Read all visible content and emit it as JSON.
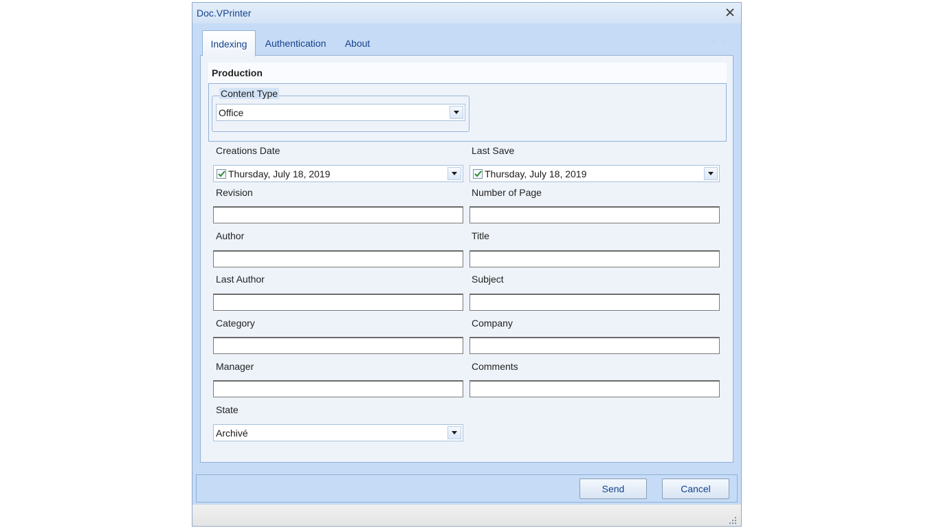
{
  "window": {
    "title": "Doc.VPrinter"
  },
  "tabs": {
    "indexing": "Indexing",
    "authentication": "Authentication",
    "about": "About"
  },
  "production": {
    "header": "Production",
    "content_type_legend": "Content Type",
    "content_type_value": "Office"
  },
  "fields": {
    "creation_date_label": "Creations Date",
    "creation_date_value": "Thursday, July 18, 2019",
    "last_save_label": "Last Save",
    "last_save_value": "Thursday, July 18, 2019",
    "revision_label": "Revision",
    "revision_value": "",
    "number_of_page_label": "Number of Page",
    "number_of_page_value": "",
    "author_label": "Author",
    "author_value": "",
    "title_label": "Title",
    "title_value": "",
    "last_author_label": "Last Author",
    "last_author_value": "",
    "subject_label": "Subject",
    "subject_value": "",
    "category_label": "Category",
    "category_value": "",
    "company_label": "Company",
    "company_value": "",
    "manager_label": "Manager",
    "manager_value": "",
    "comments_label": "Comments",
    "comments_value": "",
    "state_label": "State",
    "state_value": "Archivé"
  },
  "buttons": {
    "send": "Send",
    "cancel": "Cancel"
  },
  "icons": {
    "close": "close-icon",
    "dropdown": "chevron-down-icon",
    "checkbox": "checkbox-checked-icon",
    "tab_scroll": "chevron-left-right-icon",
    "resize": "resize-grip-icon"
  },
  "colors": {
    "accent_text": "#15428b",
    "frame": "#c6dbf6",
    "panel": "#eef3fa",
    "check": "#2e8b2e"
  }
}
